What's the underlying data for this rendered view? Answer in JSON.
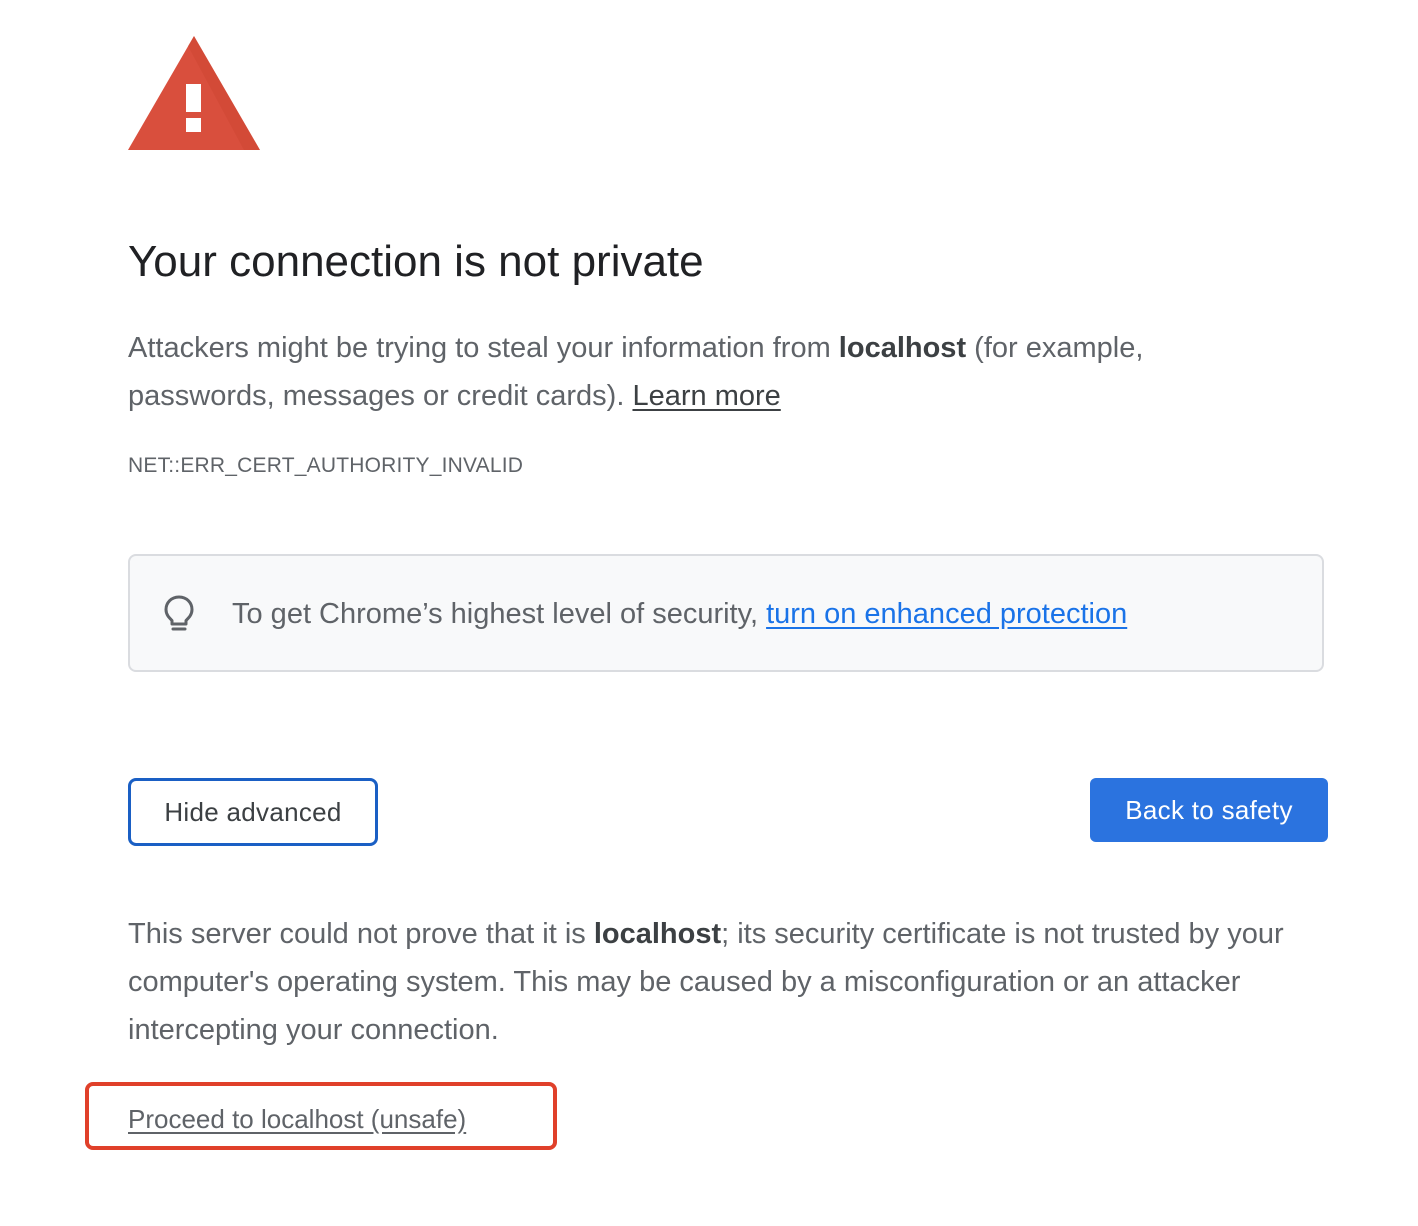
{
  "icons": {
    "warning": "warning-triangle-icon",
    "bulb": "lightbulb-icon"
  },
  "colors": {
    "warning_red": "#d94f3d",
    "link_blue": "#1a73e8",
    "primary_button": "#2b73df",
    "highlight_red": "#e0402a"
  },
  "interstitial": {
    "title": "Your connection is not private",
    "explanation": {
      "before_host": "Attackers might be trying to steal your information from ",
      "host": "localhost",
      "after_host": " (for example, passwords, messages or credit cards). ",
      "learn_more": "Learn more"
    },
    "error_code": "NET::ERR_CERT_AUTHORITY_INVALID",
    "enhanced_protection": {
      "text": "To get Chrome’s highest level of security, ",
      "link": "turn on enhanced protection"
    },
    "buttons": {
      "hide_advanced": "Hide advanced",
      "back_to_safety": "Back to safety"
    },
    "details": {
      "before_host": "This server could not prove that it is ",
      "host": "localhost",
      "after_host": "; its security certificate is not trusted by your computer's operating system. This may be caused by a misconfiguration or an attacker intercepting your connection."
    },
    "proceed_link": "Proceed to localhost (unsafe)"
  }
}
